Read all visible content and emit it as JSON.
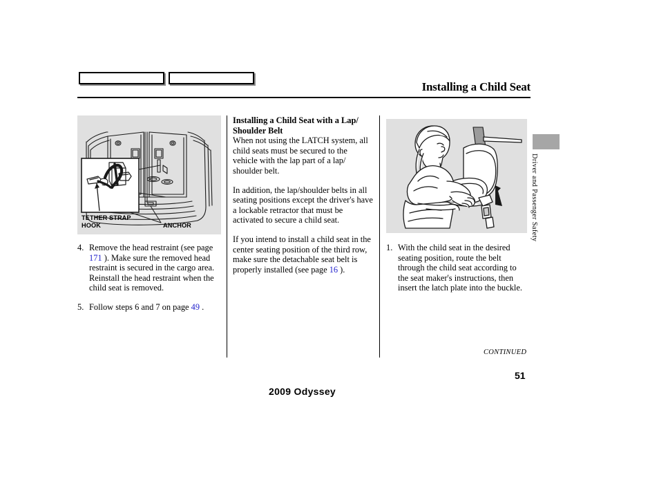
{
  "header": {
    "title": "Installing a Child Seat",
    "box1_label": "",
    "box2_label": ""
  },
  "side_tab": {
    "text": "Driver and Passenger Safety"
  },
  "columns": {
    "left": {
      "figure": {
        "name": "cargo-area-tether-anchor-illustration",
        "labels": {
          "tether_strap_hook": "TETHER STRAP\nHOOK",
          "anchor": "ANCHOR"
        }
      },
      "steps": [
        {
          "number": "4.",
          "text_before": "Remove the head restraint (see page ",
          "pageref": "171",
          "text_after": " ). Make sure the removed head restraint is secured in the cargo area. Reinstall the head restraint when the child seat is removed."
        },
        {
          "number": "5.",
          "text_before": "Follow steps 6 and 7 on page ",
          "pageref": "49",
          "text_after": " ."
        }
      ]
    },
    "middle": {
      "heading": "Installing a Child Seat with a Lap/ Shoulder Belt",
      "paragraphs": [
        "When not using the LATCH system, all child seats must be secured to the vehicle with the lap part of a lap/ shoulder belt.",
        "In addition, the lap/shoulder belts in all seating positions except the driver's have a lockable retractor that must be activated to secure a child seat."
      ],
      "paragraph_with_ref": {
        "text_before": "If you intend to install a child seat in the center seating position of the third row, make sure the detachable seat belt is properly installed (see page ",
        "pageref": "16",
        "text_after": " )."
      }
    },
    "right": {
      "figure": {
        "name": "person-installing-child-seat-illustration"
      },
      "steps": [
        {
          "number": "1.",
          "text": "With the child seat in the desired seating position, route the belt through the child seat according to the seat maker's instructions, then insert the latch plate into the buckle."
        }
      ]
    }
  },
  "footer": {
    "continued": "CONTINUED",
    "page_number": "51",
    "model": "2009  Odyssey"
  },
  "colors": {
    "figure_background": "#e0e0e0",
    "page_reference": "#2222cc",
    "side_tab": "#a6a6a6"
  }
}
